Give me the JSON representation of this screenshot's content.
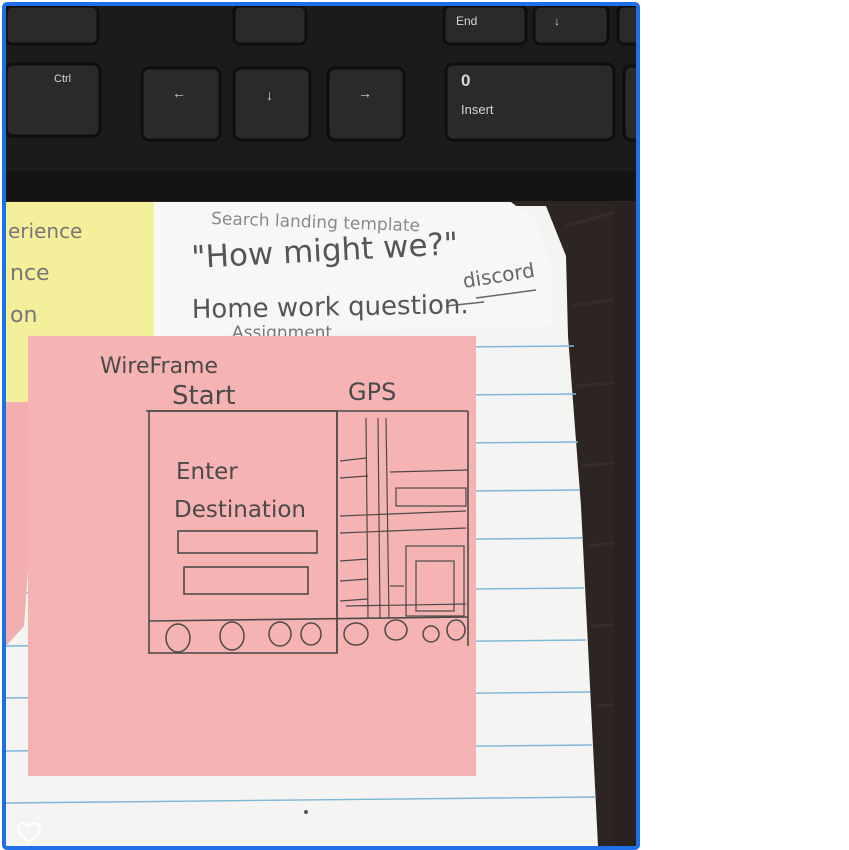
{
  "keyboard": {
    "keys": {
      "end": "End",
      "arrow_down_top": "↓",
      "ctrl": "Ctrl",
      "arrow_left": "←",
      "arrow_down": "↓",
      "arrow_right": "→",
      "zero": "0",
      "insert": "Insert"
    }
  },
  "notes": {
    "yellow_note": {
      "lines": [
        "erience",
        "nce",
        "on"
      ]
    },
    "white_note": {
      "caption": "Search landing template",
      "question": "\"How might we?\"",
      "homework": "Home work question.",
      "assignment": "Assignment",
      "tag": "discord"
    },
    "pink_note": {
      "title": "WireFrame",
      "start_label": "Start",
      "gps_label": "GPS",
      "enter_label": "Enter",
      "destination_label": "Destination"
    }
  },
  "colors": {
    "frame_border": "#1e6fe8",
    "pink_note": "#f6b3b3",
    "yellow_note": "#f3ef9a",
    "paper": "#f4f4f2",
    "rule_line": "#7cb6d8"
  },
  "viewer": {
    "favorite_icon": "heart-outline-icon"
  }
}
